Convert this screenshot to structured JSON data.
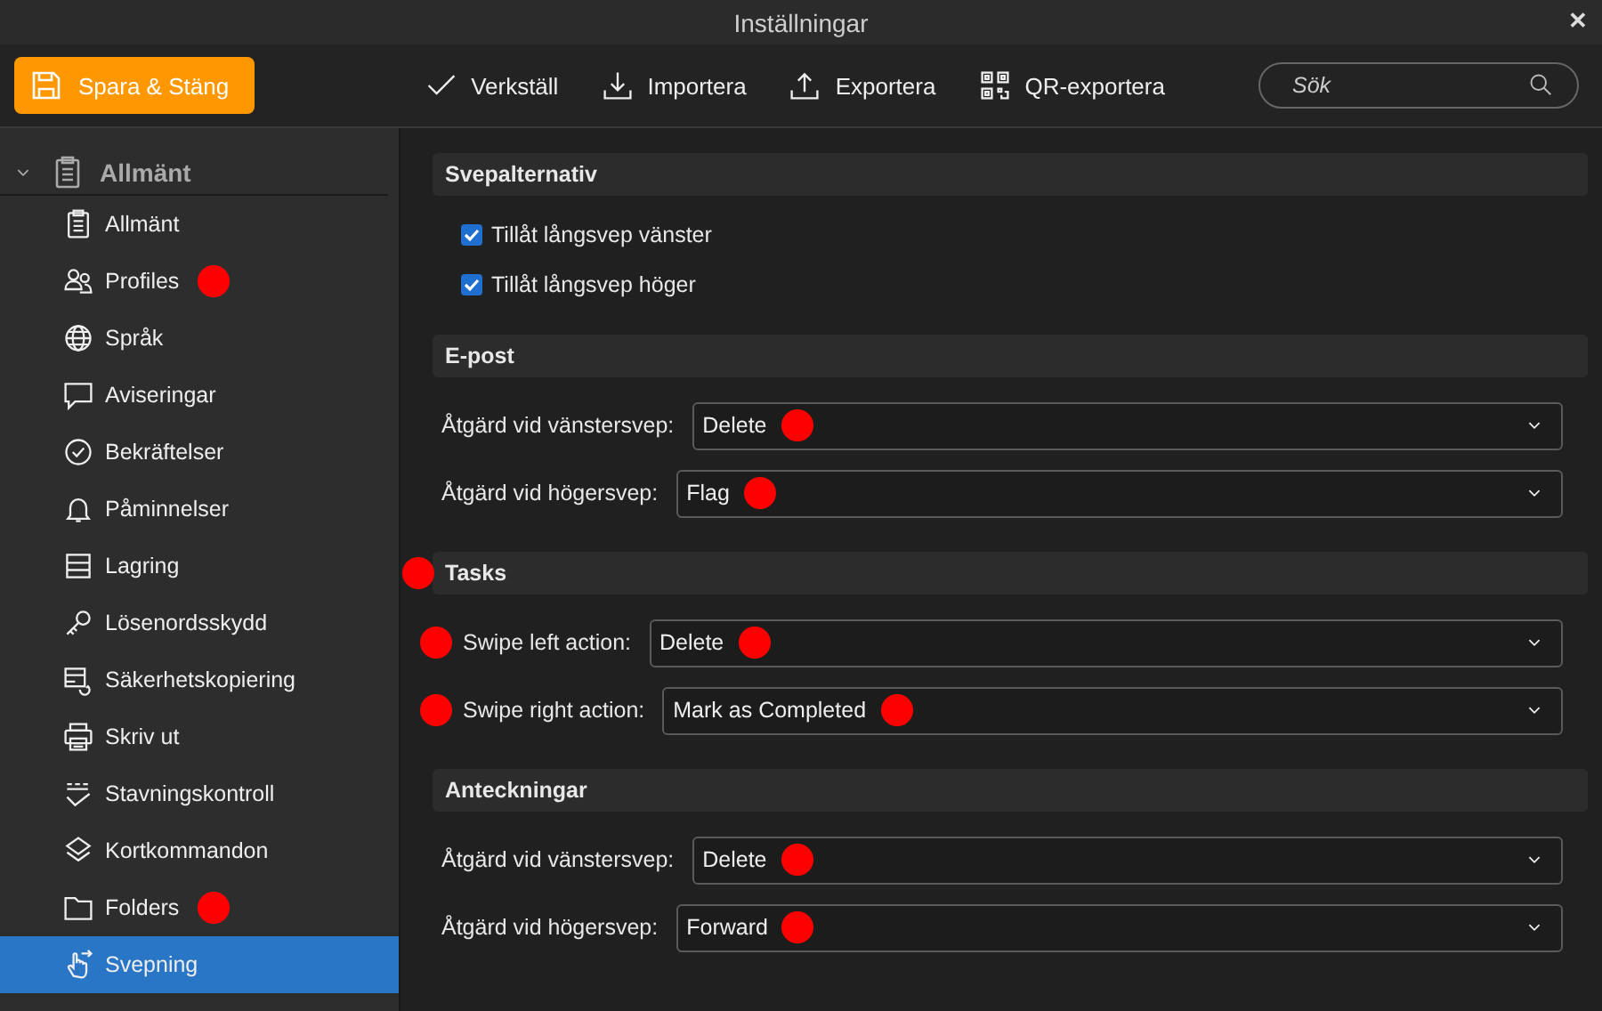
{
  "window": {
    "title": "Inställningar",
    "close": "✕"
  },
  "toolbar": {
    "save": "Spara & Stäng",
    "actions": [
      {
        "label": "Verkställ"
      },
      {
        "label": "Importera"
      },
      {
        "label": "Exportera"
      },
      {
        "label": "QR-exportera"
      }
    ],
    "search": {
      "placeholder": "Sök"
    }
  },
  "sidebar": {
    "group": {
      "label": "Allmänt",
      "expanded": true
    },
    "items": [
      {
        "label": "Allmänt",
        "selected": false,
        "marked": false
      },
      {
        "label": "Profiles",
        "selected": false,
        "marked": true
      },
      {
        "label": "Språk",
        "selected": false,
        "marked": false
      },
      {
        "label": "Aviseringar",
        "selected": false,
        "marked": false
      },
      {
        "label": "Bekräftelser",
        "selected": false,
        "marked": false
      },
      {
        "label": "Påminnelser",
        "selected": false,
        "marked": false
      },
      {
        "label": "Lagring",
        "selected": false,
        "marked": false
      },
      {
        "label": "Lösenordsskydd",
        "selected": false,
        "marked": false
      },
      {
        "label": "Säkerhetskopiering",
        "selected": false,
        "marked": false
      },
      {
        "label": "Skriv ut",
        "selected": false,
        "marked": false
      },
      {
        "label": "Stavningskontroll",
        "selected": false,
        "marked": false
      },
      {
        "label": "Kortkommandon",
        "selected": false,
        "marked": false
      },
      {
        "label": "Folders",
        "selected": false,
        "marked": true
      },
      {
        "label": "Svepning",
        "selected": true,
        "marked": false
      }
    ]
  },
  "sections": [
    {
      "title": "Svepalternativ",
      "marked": false,
      "rows": [
        {
          "kind": "checkbox",
          "label": "Tillåt långsvep vänster",
          "checked": true
        },
        {
          "kind": "checkbox",
          "label": "Tillåt långsvep höger",
          "checked": true
        }
      ]
    },
    {
      "title": "E-post",
      "marked": false,
      "rows": [
        {
          "kind": "select",
          "label": "Åtgärd vid vänstersvep:",
          "value": "Delete",
          "label_marked": false,
          "value_marked": true
        },
        {
          "kind": "select",
          "label": "Åtgärd vid högersvep:",
          "value": "Flag",
          "label_marked": false,
          "value_marked": true
        }
      ]
    },
    {
      "title": "Tasks",
      "marked": true,
      "rows": [
        {
          "kind": "select",
          "label": "Swipe left action:",
          "value": "Delete",
          "label_marked": true,
          "value_marked": true
        },
        {
          "kind": "select",
          "label": "Swipe right action:",
          "value": "Mark as Completed",
          "label_marked": true,
          "value_marked": true
        }
      ]
    },
    {
      "title": "Anteckningar",
      "marked": false,
      "rows": [
        {
          "kind": "select",
          "label": "Åtgärd vid vänstersvep:",
          "value": "Delete",
          "label_marked": false,
          "value_marked": true
        },
        {
          "kind": "select",
          "label": "Åtgärd vid högersvep:",
          "value": "Forward",
          "label_marked": false,
          "value_marked": true
        }
      ]
    }
  ]
}
